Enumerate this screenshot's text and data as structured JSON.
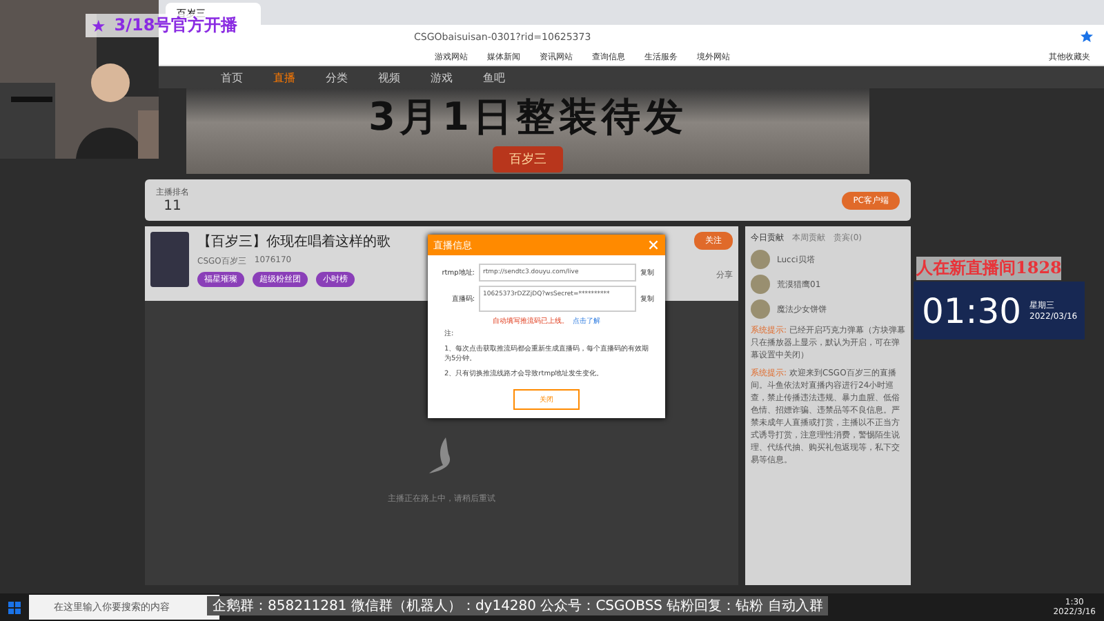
{
  "browser": {
    "tab_title": "百岁三",
    "address": "CSGObaisuisan-0301?rid=10625373",
    "bookmarks": [
      "游戏网站",
      "媒体新闻",
      "资讯网站",
      "查询信息",
      "生活服务",
      "境外网站"
    ],
    "other_bookmarks": "其他收藏夹"
  },
  "site_nav": {
    "items": [
      {
        "label": "首页",
        "selected": false
      },
      {
        "label": "直播",
        "selected": true
      },
      {
        "label": "分类",
        "selected": false
      },
      {
        "label": "视频",
        "selected": false
      },
      {
        "label": "游戏",
        "selected": false
      },
      {
        "label": "鱼吧",
        "selected": false
      }
    ]
  },
  "banner": {
    "headline": "3月1日整装待发",
    "badge": "百岁三"
  },
  "toolbar": {
    "rank_label": "主播排名",
    "rank": "11",
    "pc_button": "PC客户端"
  },
  "room": {
    "title": "【百岁三】你现在唱着这样的歌",
    "streamer": "CSGO百岁三",
    "heat": "1076170",
    "follow": "关注",
    "share": "分享",
    "tags": [
      "福星璀璨",
      "超级粉丝团",
      "小时榜"
    ],
    "offline_text": "主播正在路上中，请稍后重试"
  },
  "sidebar": {
    "tabs": [
      {
        "label": "今日贡献",
        "selected": true
      },
      {
        "label": "本周贡献",
        "selected": false
      },
      {
        "label": "贵宾(0)",
        "selected": false
      }
    ],
    "fans": [
      {
        "name": "Lucci贝塔"
      },
      {
        "name": "荒漠猎鹰01"
      },
      {
        "name": "魔法少女饼饼"
      }
    ],
    "notices": [
      {
        "label": "系统提示:",
        "text": "已经开启巧克力弹幕（方块弹幕只在播放器上显示，默认为开启，可在弹幕设置中关闭）"
      },
      {
        "label": "系统提示:",
        "text": "欢迎来到CSGO百岁三的直播间。斗鱼依法对直播内容进行24小时巡查，禁止传播违法违规、暴力血腥、低俗色情、招嫖诈骗、违禁品等不良信息。严禁未成年人直播或打赏，主播以不正当方式诱导打赏，注意理性消费，警惕陌生说理、代练代抽、购买礼包返现等，私下交易等信息。"
      }
    ]
  },
  "dialog": {
    "title": "直播信息",
    "rtmp_label": "rtmp地址:",
    "rtmp_value": "rtmp://sendtc3.douyu.com/live",
    "code_label": "直播码:",
    "code_value": "10625373rDZZjDQ?wsSecret=**********",
    "rtmp_copy": "复制",
    "code_copy": "复制",
    "warning": "自动填写推流码已上线。",
    "learn_more": "点击了解",
    "note_title": "注:",
    "notes": [
      "1、每次点击获取推流码都会重新生成直播码，每个直播码的有效期为5分钟。",
      "2、只有切换推流线路才会导致rtmp地址发生变化。"
    ],
    "close": "关闭"
  },
  "overlay": {
    "star": "★",
    "stream_text": "3/18号官方开播",
    "room_notice": "人在新直播间1828",
    "clock": "01:30",
    "weekday": "星期三",
    "date": "2022/03/16",
    "ticker": "企鹅群：858211281  微信群（机器人）：dy14280  公众号：CSGOBSS  钻粉回复：钻粉 自动入群"
  },
  "taskbar": {
    "search_placeholder": "在这里输入你要搜索的内容",
    "time": "1:30",
    "date": "2022/3/16"
  }
}
